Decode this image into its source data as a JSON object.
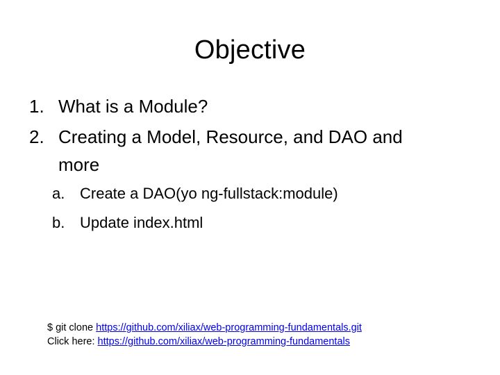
{
  "slide": {
    "title": "Objective",
    "list": [
      {
        "marker": "1.",
        "lines": [
          "What is a Module?"
        ]
      },
      {
        "marker": "2.",
        "lines": [
          "Creating a Model, Resource, and DAO and",
          "more"
        ]
      }
    ],
    "sublist": [
      {
        "marker": "a.",
        "text": "Create a DAO(yo ng-fullstack:module)"
      },
      {
        "marker": "b.",
        "text": "Update index.html"
      }
    ],
    "footer": {
      "clone_prefix": "$ git clone ",
      "clone_url": "https://github.com/xiliax/web-programming-fundamentals.git",
      "click_prefix": "Click here: ",
      "click_url": "https://github.com/xiliax/web-programming-fundamentals"
    }
  }
}
